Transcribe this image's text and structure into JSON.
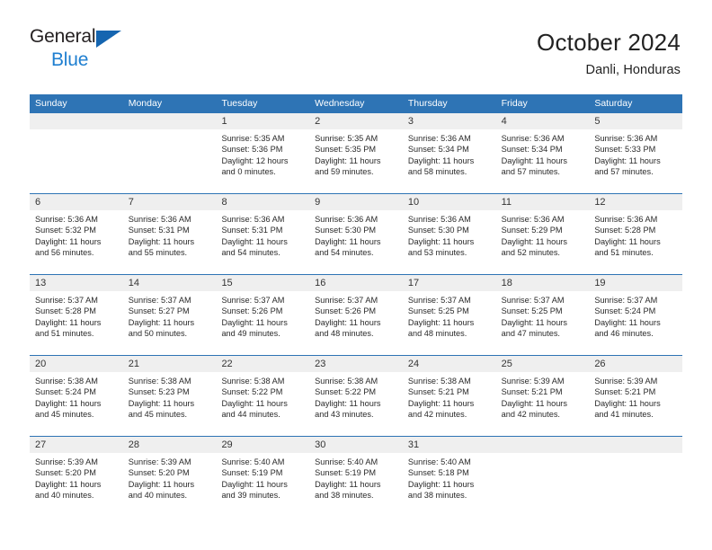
{
  "brand": {
    "name_part1": "General",
    "name_part2": "Blue",
    "triangle_icon": "triangle-icon",
    "color_dark": "#231f20",
    "color_blue": "#1f7fd0",
    "triangle_color": "#1565b0"
  },
  "header": {
    "title": "October 2024",
    "subtitle": "Danli, Honduras"
  },
  "theme": {
    "header_blue": "#2e74b5",
    "day_strip_gray": "#efefef",
    "text_color": "#2a2a2a"
  },
  "weekdays": [
    "Sunday",
    "Monday",
    "Tuesday",
    "Wednesday",
    "Thursday",
    "Friday",
    "Saturday"
  ],
  "weeks": [
    [
      {
        "day": "",
        "sunrise": "",
        "sunset": "",
        "daylight_line1": "",
        "daylight_line2": "",
        "empty": true
      },
      {
        "day": "",
        "sunrise": "",
        "sunset": "",
        "daylight_line1": "",
        "daylight_line2": "",
        "empty": true
      },
      {
        "day": "1",
        "sunrise": "Sunrise: 5:35 AM",
        "sunset": "Sunset: 5:36 PM",
        "daylight_line1": "Daylight: 12 hours",
        "daylight_line2": "and 0 minutes."
      },
      {
        "day": "2",
        "sunrise": "Sunrise: 5:35 AM",
        "sunset": "Sunset: 5:35 PM",
        "daylight_line1": "Daylight: 11 hours",
        "daylight_line2": "and 59 minutes."
      },
      {
        "day": "3",
        "sunrise": "Sunrise: 5:36 AM",
        "sunset": "Sunset: 5:34 PM",
        "daylight_line1": "Daylight: 11 hours",
        "daylight_line2": "and 58 minutes."
      },
      {
        "day": "4",
        "sunrise": "Sunrise: 5:36 AM",
        "sunset": "Sunset: 5:34 PM",
        "daylight_line1": "Daylight: 11 hours",
        "daylight_line2": "and 57 minutes."
      },
      {
        "day": "5",
        "sunrise": "Sunrise: 5:36 AM",
        "sunset": "Sunset: 5:33 PM",
        "daylight_line1": "Daylight: 11 hours",
        "daylight_line2": "and 57 minutes."
      }
    ],
    [
      {
        "day": "6",
        "sunrise": "Sunrise: 5:36 AM",
        "sunset": "Sunset: 5:32 PM",
        "daylight_line1": "Daylight: 11 hours",
        "daylight_line2": "and 56 minutes."
      },
      {
        "day": "7",
        "sunrise": "Sunrise: 5:36 AM",
        "sunset": "Sunset: 5:31 PM",
        "daylight_line1": "Daylight: 11 hours",
        "daylight_line2": "and 55 minutes."
      },
      {
        "day": "8",
        "sunrise": "Sunrise: 5:36 AM",
        "sunset": "Sunset: 5:31 PM",
        "daylight_line1": "Daylight: 11 hours",
        "daylight_line2": "and 54 minutes."
      },
      {
        "day": "9",
        "sunrise": "Sunrise: 5:36 AM",
        "sunset": "Sunset: 5:30 PM",
        "daylight_line1": "Daylight: 11 hours",
        "daylight_line2": "and 54 minutes."
      },
      {
        "day": "10",
        "sunrise": "Sunrise: 5:36 AM",
        "sunset": "Sunset: 5:30 PM",
        "daylight_line1": "Daylight: 11 hours",
        "daylight_line2": "and 53 minutes."
      },
      {
        "day": "11",
        "sunrise": "Sunrise: 5:36 AM",
        "sunset": "Sunset: 5:29 PM",
        "daylight_line1": "Daylight: 11 hours",
        "daylight_line2": "and 52 minutes."
      },
      {
        "day": "12",
        "sunrise": "Sunrise: 5:36 AM",
        "sunset": "Sunset: 5:28 PM",
        "daylight_line1": "Daylight: 11 hours",
        "daylight_line2": "and 51 minutes."
      }
    ],
    [
      {
        "day": "13",
        "sunrise": "Sunrise: 5:37 AM",
        "sunset": "Sunset: 5:28 PM",
        "daylight_line1": "Daylight: 11 hours",
        "daylight_line2": "and 51 minutes."
      },
      {
        "day": "14",
        "sunrise": "Sunrise: 5:37 AM",
        "sunset": "Sunset: 5:27 PM",
        "daylight_line1": "Daylight: 11 hours",
        "daylight_line2": "and 50 minutes."
      },
      {
        "day": "15",
        "sunrise": "Sunrise: 5:37 AM",
        "sunset": "Sunset: 5:26 PM",
        "daylight_line1": "Daylight: 11 hours",
        "daylight_line2": "and 49 minutes."
      },
      {
        "day": "16",
        "sunrise": "Sunrise: 5:37 AM",
        "sunset": "Sunset: 5:26 PM",
        "daylight_line1": "Daylight: 11 hours",
        "daylight_line2": "and 48 minutes."
      },
      {
        "day": "17",
        "sunrise": "Sunrise: 5:37 AM",
        "sunset": "Sunset: 5:25 PM",
        "daylight_line1": "Daylight: 11 hours",
        "daylight_line2": "and 48 minutes."
      },
      {
        "day": "18",
        "sunrise": "Sunrise: 5:37 AM",
        "sunset": "Sunset: 5:25 PM",
        "daylight_line1": "Daylight: 11 hours",
        "daylight_line2": "and 47 minutes."
      },
      {
        "day": "19",
        "sunrise": "Sunrise: 5:37 AM",
        "sunset": "Sunset: 5:24 PM",
        "daylight_line1": "Daylight: 11 hours",
        "daylight_line2": "and 46 minutes."
      }
    ],
    [
      {
        "day": "20",
        "sunrise": "Sunrise: 5:38 AM",
        "sunset": "Sunset: 5:24 PM",
        "daylight_line1": "Daylight: 11 hours",
        "daylight_line2": "and 45 minutes."
      },
      {
        "day": "21",
        "sunrise": "Sunrise: 5:38 AM",
        "sunset": "Sunset: 5:23 PM",
        "daylight_line1": "Daylight: 11 hours",
        "daylight_line2": "and 45 minutes."
      },
      {
        "day": "22",
        "sunrise": "Sunrise: 5:38 AM",
        "sunset": "Sunset: 5:22 PM",
        "daylight_line1": "Daylight: 11 hours",
        "daylight_line2": "and 44 minutes."
      },
      {
        "day": "23",
        "sunrise": "Sunrise: 5:38 AM",
        "sunset": "Sunset: 5:22 PM",
        "daylight_line1": "Daylight: 11 hours",
        "daylight_line2": "and 43 minutes."
      },
      {
        "day": "24",
        "sunrise": "Sunrise: 5:38 AM",
        "sunset": "Sunset: 5:21 PM",
        "daylight_line1": "Daylight: 11 hours",
        "daylight_line2": "and 42 minutes."
      },
      {
        "day": "25",
        "sunrise": "Sunrise: 5:39 AM",
        "sunset": "Sunset: 5:21 PM",
        "daylight_line1": "Daylight: 11 hours",
        "daylight_line2": "and 42 minutes."
      },
      {
        "day": "26",
        "sunrise": "Sunrise: 5:39 AM",
        "sunset": "Sunset: 5:21 PM",
        "daylight_line1": "Daylight: 11 hours",
        "daylight_line2": "and 41 minutes."
      }
    ],
    [
      {
        "day": "27",
        "sunrise": "Sunrise: 5:39 AM",
        "sunset": "Sunset: 5:20 PM",
        "daylight_line1": "Daylight: 11 hours",
        "daylight_line2": "and 40 minutes."
      },
      {
        "day": "28",
        "sunrise": "Sunrise: 5:39 AM",
        "sunset": "Sunset: 5:20 PM",
        "daylight_line1": "Daylight: 11 hours",
        "daylight_line2": "and 40 minutes."
      },
      {
        "day": "29",
        "sunrise": "Sunrise: 5:40 AM",
        "sunset": "Sunset: 5:19 PM",
        "daylight_line1": "Daylight: 11 hours",
        "daylight_line2": "and 39 minutes."
      },
      {
        "day": "30",
        "sunrise": "Sunrise: 5:40 AM",
        "sunset": "Sunset: 5:19 PM",
        "daylight_line1": "Daylight: 11 hours",
        "daylight_line2": "and 38 minutes."
      },
      {
        "day": "31",
        "sunrise": "Sunrise: 5:40 AM",
        "sunset": "Sunset: 5:18 PM",
        "daylight_line1": "Daylight: 11 hours",
        "daylight_line2": "and 38 minutes."
      },
      {
        "day": "",
        "sunrise": "",
        "sunset": "",
        "daylight_line1": "",
        "daylight_line2": "",
        "empty": true
      },
      {
        "day": "",
        "sunrise": "",
        "sunset": "",
        "daylight_line1": "",
        "daylight_line2": "",
        "empty": true
      }
    ]
  ]
}
